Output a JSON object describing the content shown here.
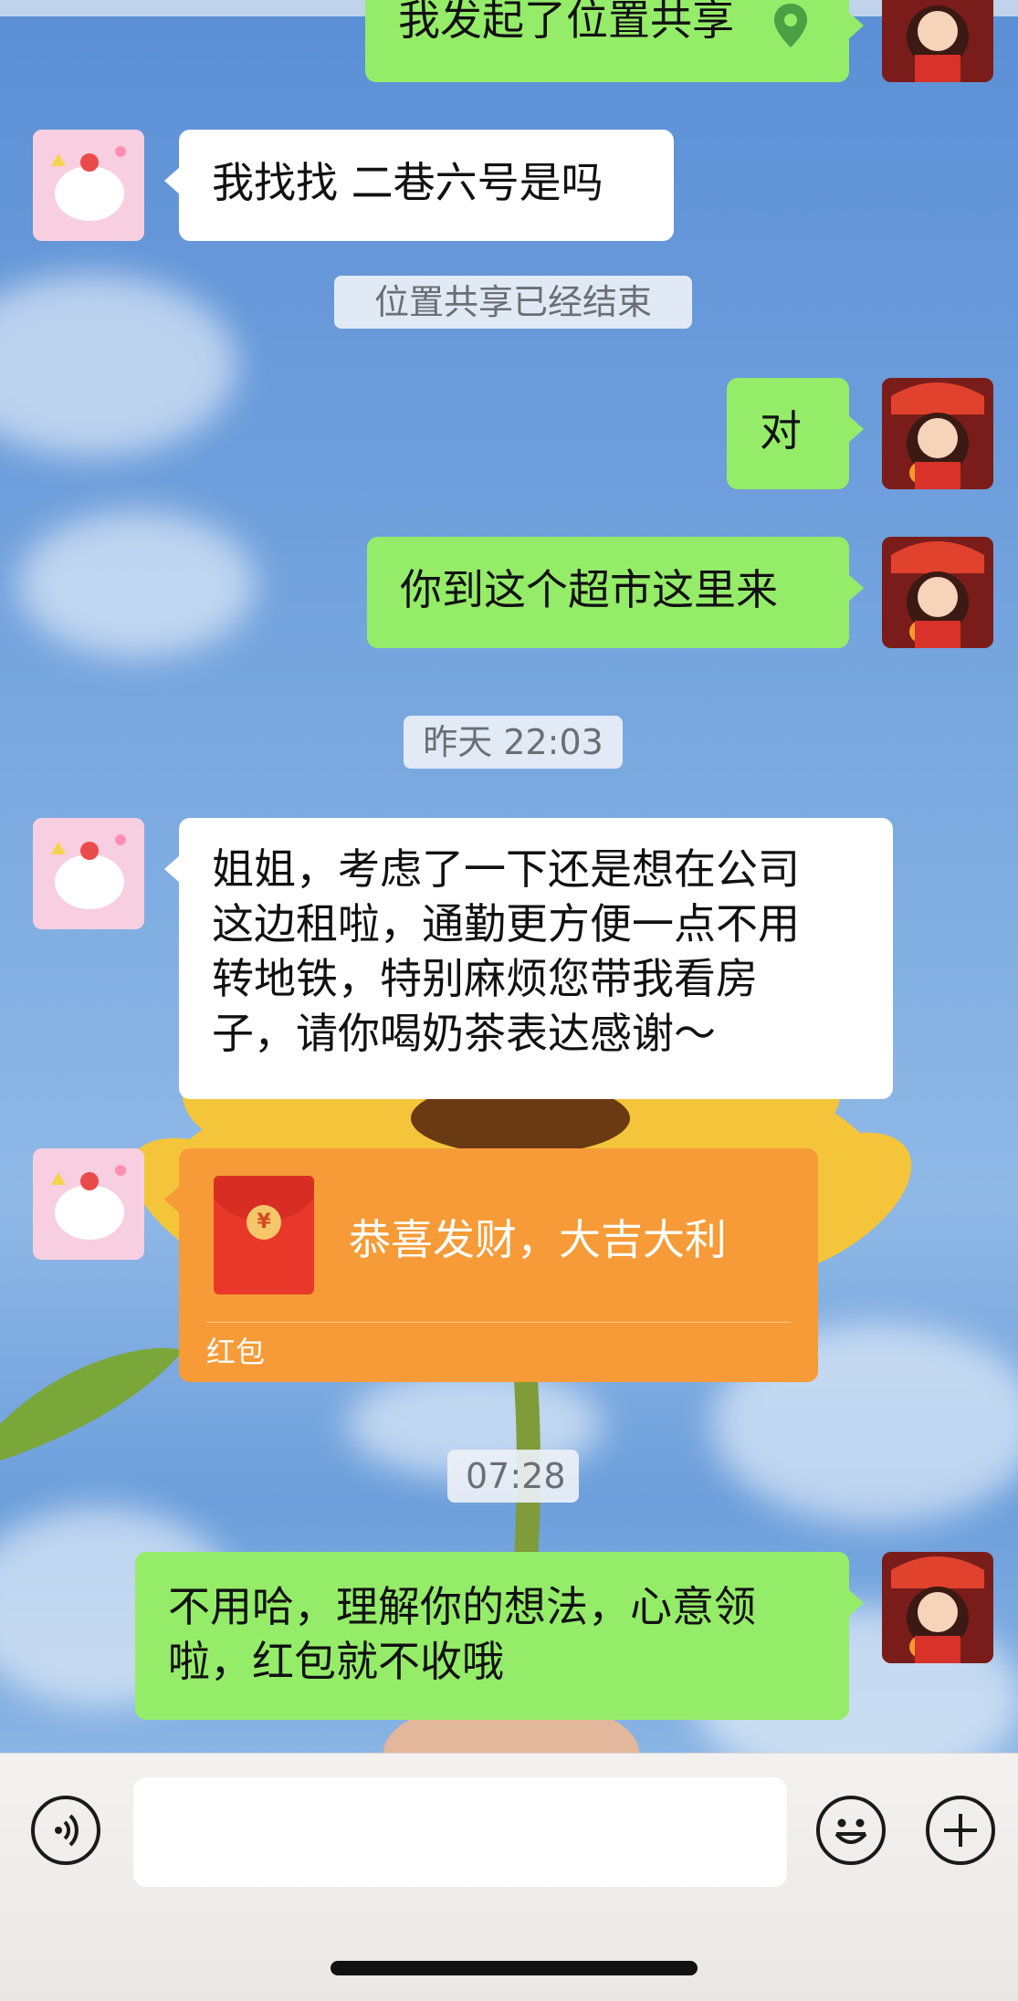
{
  "chat": {
    "messages": [
      {
        "id": "m1",
        "sender": "me",
        "type": "location",
        "text": "我发起了位置共享"
      },
      {
        "id": "m2",
        "sender": "friend",
        "type": "text",
        "text": "我找找 二巷六号是吗"
      },
      {
        "id": "s1",
        "type": "system",
        "text": "位置共享已经结束"
      },
      {
        "id": "m3",
        "sender": "me",
        "type": "text",
        "text": "对"
      },
      {
        "id": "m4",
        "sender": "me",
        "type": "text",
        "text": "你到这个超市这里来"
      },
      {
        "id": "t1",
        "type": "timestamp",
        "text": "昨天 22:03"
      },
      {
        "id": "m5",
        "sender": "friend",
        "type": "text",
        "lines": [
          "姐姐，考虑了一下还是想在公司",
          "这边租啦，通勤更方便一点不用",
          "转地铁，特别麻烦您带我看房",
          "子，请你喝奶茶表达感谢～"
        ]
      },
      {
        "id": "m6",
        "sender": "friend",
        "type": "red_packet",
        "greeting": "恭喜发财，大吉大利",
        "label": "红包"
      },
      {
        "id": "t2",
        "type": "timestamp",
        "text": "07:28"
      },
      {
        "id": "m7",
        "sender": "me",
        "type": "text",
        "lines": [
          "不用哈，理解你的想法，心意领",
          "啦，红包就不收哦"
        ]
      }
    ]
  },
  "input_bar": {
    "voice_icon": "voice-icon",
    "emoji_icon": "emoji-icon",
    "add_icon": "plus-icon",
    "message_value": ""
  },
  "colors": {
    "my_bubble": "#95ec69",
    "friend_bubble": "#ffffff",
    "red_packet": "#f69b37"
  }
}
